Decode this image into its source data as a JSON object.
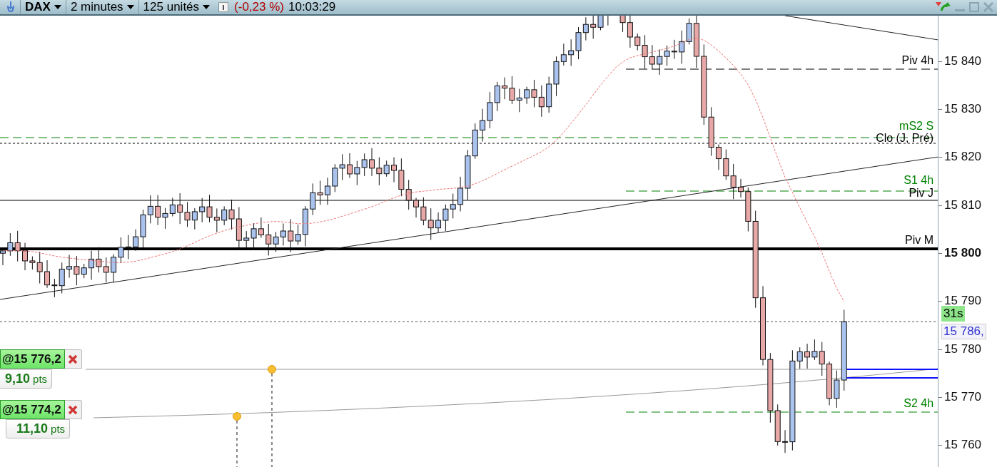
{
  "toolbar": {
    "symbol": "DAX",
    "timeframe": "2 minutes",
    "units": "125 unités",
    "change": "(-0,23 %)",
    "time": "10:03:29"
  },
  "levels": [
    {
      "label": "Piv 4h",
      "kind": "dashed",
      "color": "#000000"
    },
    {
      "label": "mS2 S",
      "kind": "dashed",
      "color": "#008000"
    },
    {
      "label": "Clo (J, Pré)",
      "kind": "dotted",
      "color": "#000000"
    },
    {
      "label": "S1 4h",
      "kind": "dashed",
      "color": "#008000"
    },
    {
      "label": "Piv J",
      "kind": "solid",
      "color": "#000000"
    },
    {
      "label": "Piv M",
      "kind": "thick",
      "color": "#000000"
    },
    {
      "label": "S2 4h",
      "kind": "dashed",
      "color": "#008000"
    }
  ],
  "axis_ticks": [
    {
      "label": "15 840",
      "emphasized": false
    },
    {
      "label": "15 830",
      "emphasized": false
    },
    {
      "label": "15 820",
      "emphasized": false
    },
    {
      "label": "15 810",
      "emphasized": false
    },
    {
      "label": "15 800",
      "emphasized": true
    },
    {
      "label": "15 790",
      "emphasized": false
    },
    {
      "label": "15 780",
      "emphasized": false
    },
    {
      "label": "15 770",
      "emphasized": false
    },
    {
      "label": "15 760",
      "emphasized": false
    }
  ],
  "countdown": "31s",
  "last_price": "15 786,",
  "orders": [
    {
      "price": "@15 776,2",
      "distance": "**9,10** pts"
    },
    {
      "price": "@15 774,2",
      "distance": "**11,10** pts"
    }
  ]
}
